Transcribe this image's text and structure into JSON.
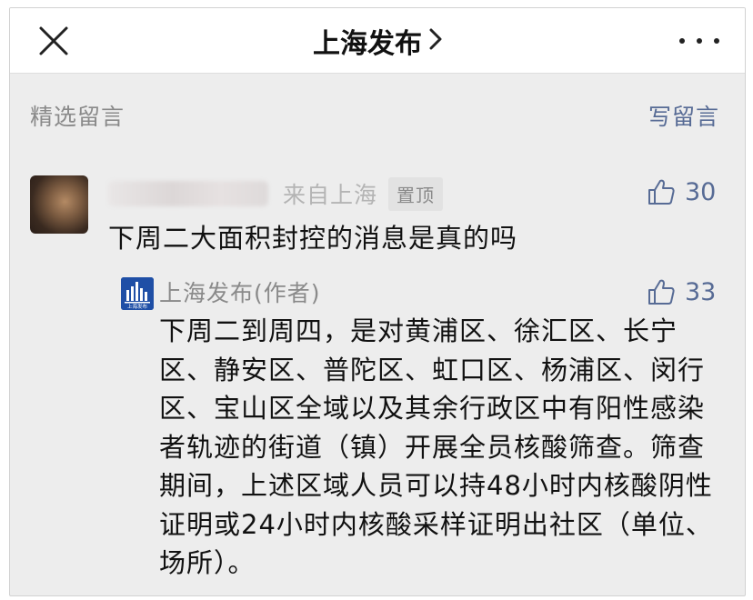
{
  "header": {
    "title": "上海发布",
    "close_icon": "close-icon",
    "chevron_icon": "chevron-right-icon",
    "more_icon": "more-dots-icon"
  },
  "section": {
    "title": "精选留言",
    "write_label": "写留言"
  },
  "comment": {
    "location": "来自上海",
    "pinned_label": "置顶",
    "like_count": "30",
    "text": "下周二大面积封控的消息是真的吗"
  },
  "reply": {
    "author": "上海发布(作者)",
    "like_count": "33",
    "text": "下周二到周四，是对黄浦区、徐汇区、长宁区、静安区、普陀区、虹口区、杨浦区、闵行区、宝山区全域以及其余行政区中有阳性感染者轨迹的街道（镇）开展全员核酸筛查。筛查期间，上述区域人员可以持48小时内核酸阴性证明或24小时内核酸采样证明出社区（单位、场所）。",
    "avatar_logo_text": "上海发布"
  },
  "colors": {
    "accent_link": "#576b95",
    "muted_text": "#8a8a8a",
    "background": "#ededed",
    "avatar_blue": "#1f4fa6"
  }
}
